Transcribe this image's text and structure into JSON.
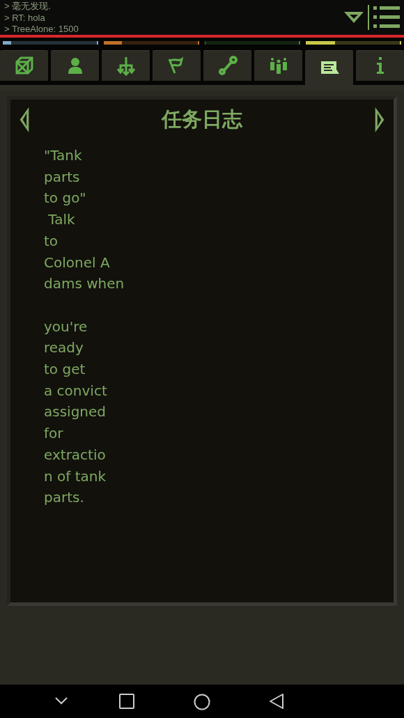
{
  "log": [
    "> 毫无发现.",
    "> RT: hola",
    "> TreeAlone: 1500"
  ],
  "meters": [
    {
      "level": 0.09,
      "color": "#7fa8c8"
    },
    {
      "level": 0.19,
      "color": "#c0702a"
    },
    {
      "level": 0.01,
      "color": "#3f7a34"
    },
    {
      "level": 0.31,
      "color": "#c8c84a"
    }
  ],
  "tabs": [
    {
      "kind": "crate",
      "selected": false
    },
    {
      "kind": "person",
      "selected": false
    },
    {
      "kind": "branch",
      "selected": false
    },
    {
      "kind": "flag",
      "selected": false
    },
    {
      "kind": "wrench",
      "selected": false
    },
    {
      "kind": "squad",
      "selected": false
    },
    {
      "kind": "note",
      "selected": true
    },
    {
      "kind": "info",
      "selected": false
    }
  ],
  "panel": {
    "title": "任务日志",
    "paragraphs": [
      [
        "\"Tank",
        "parts",
        "to go\"",
        " Talk",
        "to",
        "Colonel A",
        "dams when"
      ],
      [
        "you're",
        "ready",
        "to get",
        "a convict",
        "assigned",
        "for",
        "extractio",
        "n of tank",
        "parts."
      ]
    ]
  }
}
